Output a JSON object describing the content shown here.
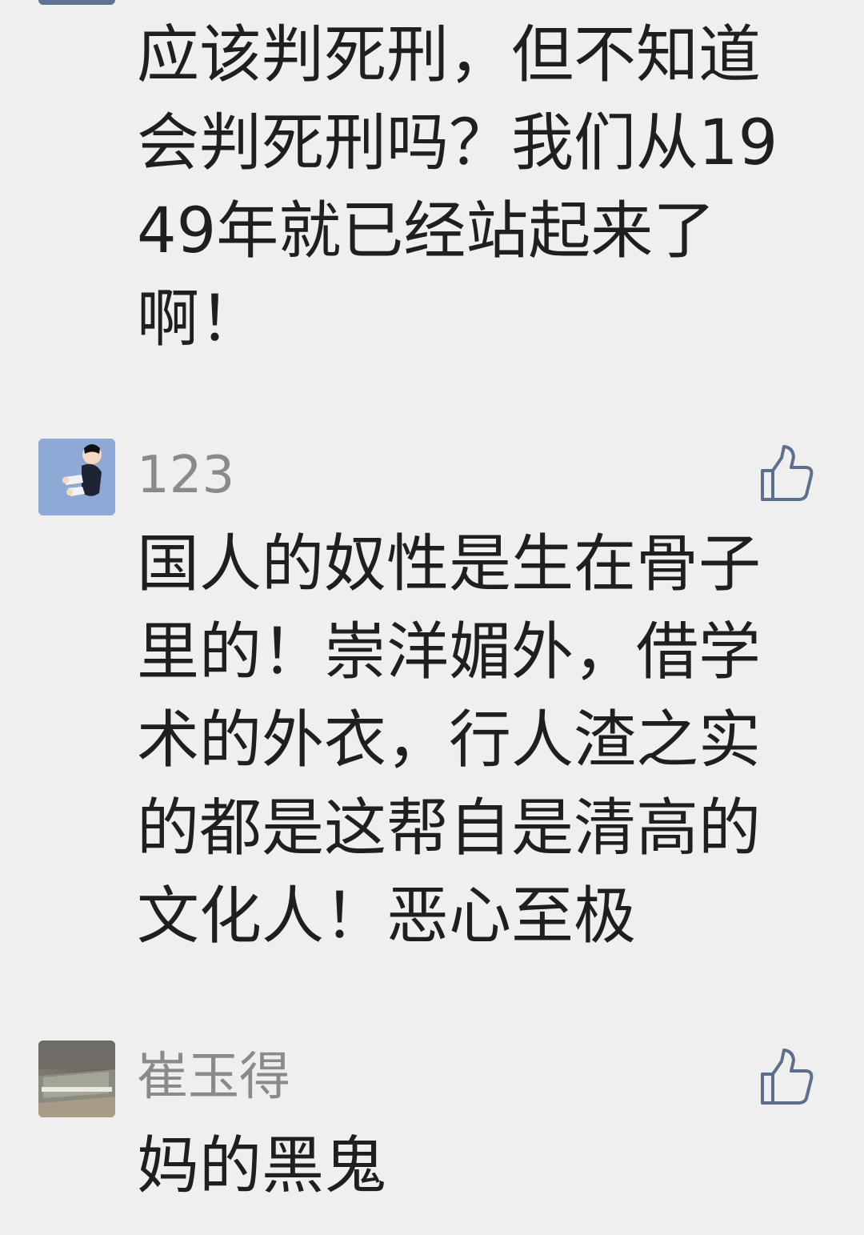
{
  "comments": [
    {
      "text": "应该判死刑，但不知道会判死刑吗？我们从1949年就已经站起来了啊！"
    },
    {
      "user": "123",
      "avatar_icon": "boy-sitting-avatar-icon",
      "like_icon": "thumbs-up-icon",
      "text": "国人的奴性是生在骨子里的！崇洋媚外，借学术的外衣，行人渣之实的都是这帮自是清高的文化人！恶心至极"
    },
    {
      "user": "崔玉得",
      "avatar_icon": "room-photo-avatar-icon",
      "like_icon": "thumbs-up-icon",
      "text": "妈的黑鬼"
    }
  ],
  "colors": {
    "background": "#efefef",
    "username": "#8a8a8a",
    "text": "#1f1f1f",
    "like_icon": "#5d6f8f"
  }
}
